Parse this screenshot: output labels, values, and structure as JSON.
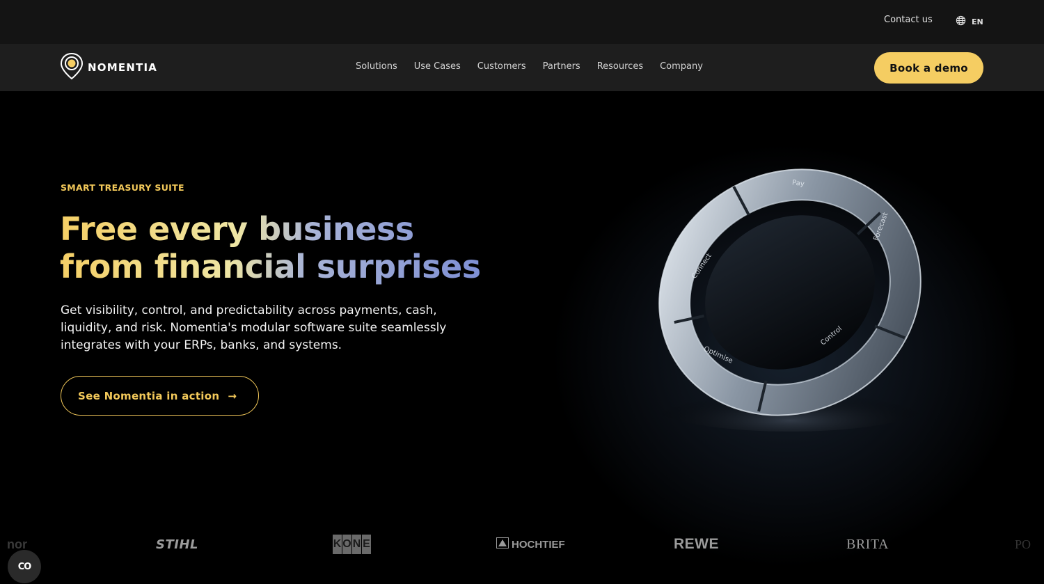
{
  "topbar": {
    "contact_label": "Contact us",
    "language": "EN"
  },
  "nav": {
    "brand": "NOMENTIA",
    "items": [
      "Solutions",
      "Use Cases",
      "Customers",
      "Partners",
      "Resources",
      "Company"
    ],
    "cta_label": "Book a demo"
  },
  "hero": {
    "eyebrow": "SMART TREASURY SUITE",
    "headline_line1": "Free every business",
    "headline_line2": "from financial surprises",
    "subtext": "Get visibility, control, and predictability across payments, cash, liquidity, and risk. Nomentia's modular software suite seamlessly integrates with your ERPs, banks, and systems.",
    "cta_label": "See Nomentia in action",
    "ring_segments": [
      "Pay",
      "Forecast",
      "Control",
      "Optimise",
      "Connect"
    ]
  },
  "customer_logos": {
    "left_partial": "nor",
    "stihl": "STIHL",
    "kone": [
      "K",
      "O",
      "N",
      "E"
    ],
    "hochtief": "HOCHTIEF",
    "rewe": "REWE",
    "brita": "BRITA",
    "right_partial": "PO"
  },
  "colors": {
    "accent": "#f5cd62",
    "background": "#000000",
    "nav_bg": "#1e1e1e",
    "topbar_bg": "#141414",
    "headline_blue": "#7e8fd4"
  },
  "cookie_widget": {
    "label": "CO",
    "icon": "cookie-consent-icon"
  }
}
